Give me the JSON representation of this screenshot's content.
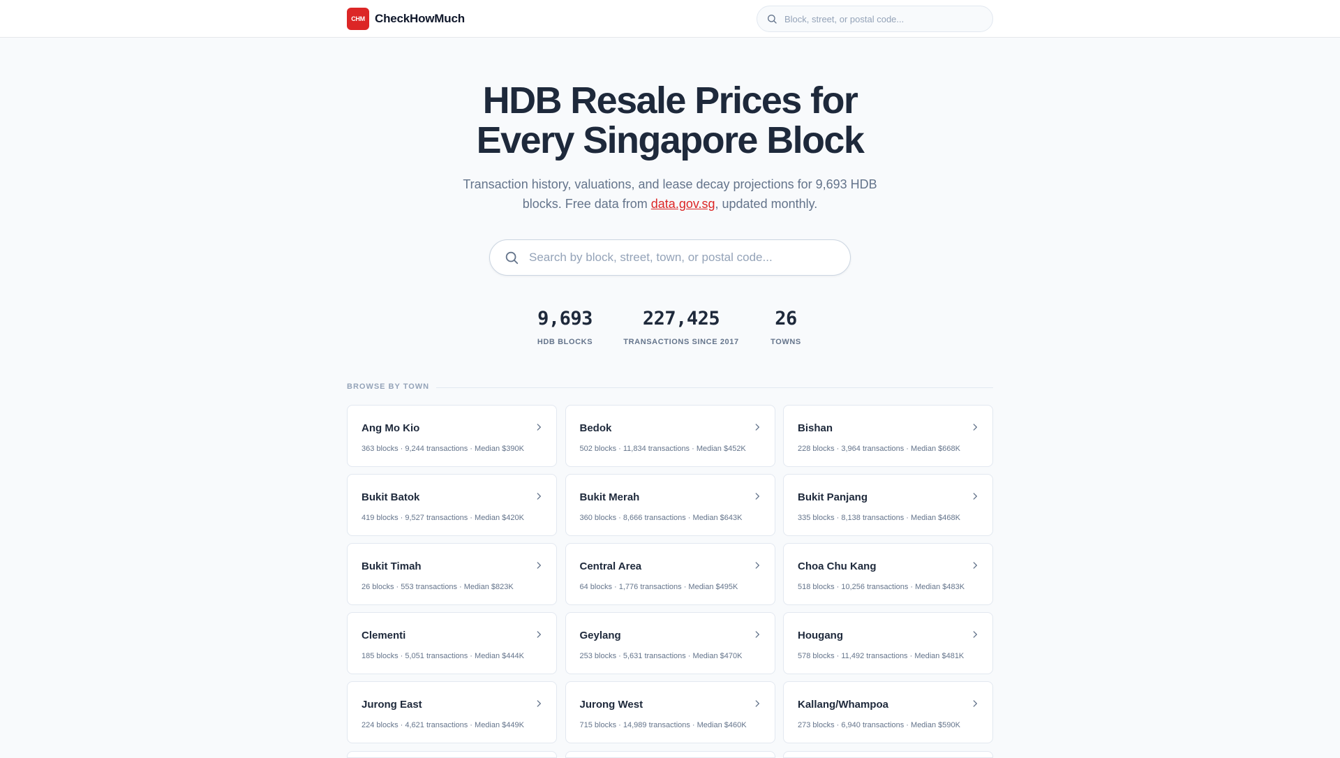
{
  "header": {
    "logo_text": "CHM",
    "brand": "CheckHowMuch",
    "search_placeholder": "Block, street, or postal code..."
  },
  "hero": {
    "title_line1": "HDB Resale Prices for",
    "title_line2": "Every Singapore Block",
    "subtitle_part1": "Transaction history, valuations, and lease decay projections for 9,693 HDB blocks. Free data from ",
    "subtitle_link": "data.gov.sg",
    "subtitle_part2": ", updated monthly.",
    "search_placeholder": "Search by block, street, town, or postal code..."
  },
  "stats": [
    {
      "value": "9,693",
      "label": "HDB BLOCKS"
    },
    {
      "value": "227,425",
      "label": "TRANSACTIONS SINCE 2017"
    },
    {
      "value": "26",
      "label": "TOWNS"
    }
  ],
  "browse": {
    "title": "BROWSE BY TOWN",
    "towns": [
      {
        "name": "Ang Mo Kio",
        "meta": "363 blocks · 9,244 transactions · Median $390K"
      },
      {
        "name": "Bedok",
        "meta": "502 blocks · 11,834 transactions · Median $452K"
      },
      {
        "name": "Bishan",
        "meta": "228 blocks · 3,964 transactions · Median $668K"
      },
      {
        "name": "Bukit Batok",
        "meta": "419 blocks · 9,527 transactions · Median $420K"
      },
      {
        "name": "Bukit Merah",
        "meta": "360 blocks · 8,666 transactions · Median $643K"
      },
      {
        "name": "Bukit Panjang",
        "meta": "335 blocks · 8,138 transactions · Median $468K"
      },
      {
        "name": "Bukit Timah",
        "meta": "26 blocks · 553 transactions · Median $823K"
      },
      {
        "name": "Central Area",
        "meta": "64 blocks · 1,776 transactions · Median $495K"
      },
      {
        "name": "Choa Chu Kang",
        "meta": "518 blocks · 10,256 transactions · Median $483K"
      },
      {
        "name": "Clementi",
        "meta": "185 blocks · 5,051 transactions · Median $444K"
      },
      {
        "name": "Geylang",
        "meta": "253 blocks · 5,631 transactions · Median $470K"
      },
      {
        "name": "Hougang",
        "meta": "578 blocks · 11,492 transactions · Median $481K"
      },
      {
        "name": "Jurong East",
        "meta": "224 blocks · 4,621 transactions · Median $449K"
      },
      {
        "name": "Jurong West",
        "meta": "715 blocks · 14,989 transactions · Median $460K"
      },
      {
        "name": "Kallang/Whampoa",
        "meta": "273 blocks · 6,940 transactions · Median $590K"
      }
    ]
  }
}
